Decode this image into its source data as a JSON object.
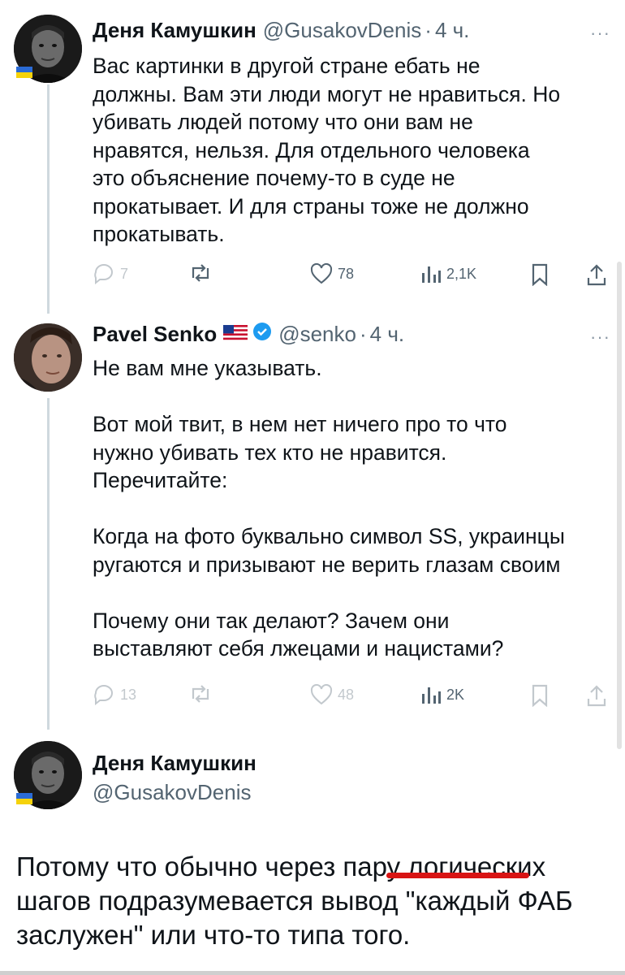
{
  "tweet1": {
    "name": "Деня Камушкин",
    "handle": "@GusakovDenis",
    "separator": "·",
    "time": "4 ч.",
    "more": "···",
    "text": "Вас картинки в другой стране ебать не\nдолжны. Вам эти люди могут не нравиться. Но\nубивать людей потому что они вам не\nнравятся, нельзя. Для отдельного человека\nэто объяснение почему-то в суде не\nпрокатывает. И для страны тоже не должно\nпрокатывать.",
    "replies": "7",
    "retweets": "",
    "likes": "78",
    "views": "2,1K"
  },
  "tweet2": {
    "name": "Pavel Senko",
    "handle": "@senko",
    "separator": "·",
    "time": "4 ч.",
    "more": "···",
    "text": "Не вам мне указывать.\n\nВот мой твит, в нем нет ничего про то что\nнужно убивать тех кто не нравится.\nПеречитайте:\n\nКогда на фото буквально символ SS, украинцы\nругаются и призывают не верить глазам своим\n\nПочему они так делают? Зачем они\nвыставляют себя лжецами и нацистами?",
    "replies": "13",
    "likes": "48",
    "views": "2K"
  },
  "tweet3": {
    "name": "Деня Камушкин",
    "handle": "@GusakovDenis",
    "text": "Потому что обычно через пару логических\nшагов подразумевается вывод \"каждый ФАБ\nзаслужен\" или что-то типа того."
  },
  "colors": {
    "text": "#0f1419",
    "secondary": "#536471",
    "verified": "#1d9bf0",
    "underline": "#d81414",
    "thread_line": "#cfd9de"
  },
  "icons": [
    "reply-icon",
    "retweet-icon",
    "like-icon",
    "views-icon",
    "bookmark-icon",
    "share-icon",
    "verified-icon",
    "us-flag-icon",
    "ukraine-flag-badge"
  ]
}
